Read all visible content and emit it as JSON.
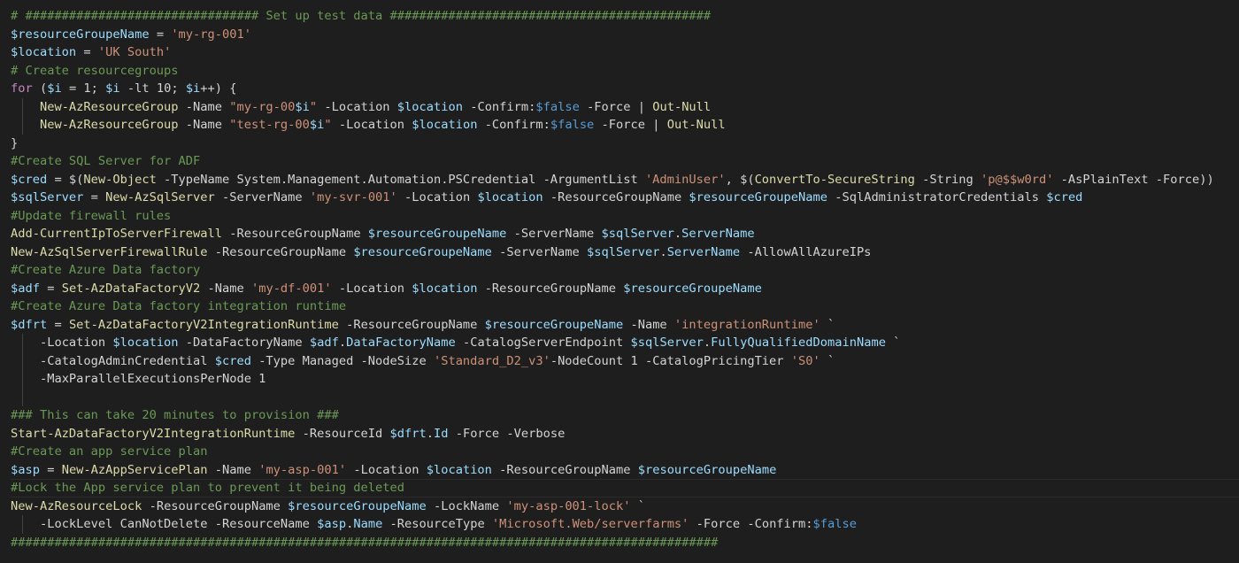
{
  "editor": {
    "background": "#1e1e1e",
    "current_line": 26,
    "lines": [
      {
        "indent": 0,
        "tokens": [
          {
            "t": "com",
            "v": "# ################################ Set up test data ############################################"
          }
        ]
      },
      {
        "indent": 0,
        "tokens": [
          {
            "t": "var",
            "v": "$resourceGroupeName"
          },
          {
            "t": "txt",
            "v": " = "
          },
          {
            "t": "str",
            "v": "'my-rg-001'"
          }
        ]
      },
      {
        "indent": 0,
        "tokens": [
          {
            "t": "var",
            "v": "$location"
          },
          {
            "t": "txt",
            "v": " = "
          },
          {
            "t": "str",
            "v": "'UK South'"
          }
        ]
      },
      {
        "indent": 0,
        "tokens": [
          {
            "t": "com",
            "v": "# Create resourcegroups"
          }
        ]
      },
      {
        "indent": 0,
        "tokens": [
          {
            "t": "kw",
            "v": "for"
          },
          {
            "t": "txt",
            "v": " ("
          },
          {
            "t": "var",
            "v": "$i"
          },
          {
            "t": "txt",
            "v": " = 1; "
          },
          {
            "t": "var",
            "v": "$i"
          },
          {
            "t": "txt",
            "v": " -lt 10; "
          },
          {
            "t": "var",
            "v": "$i"
          },
          {
            "t": "txt",
            "v": "++) {"
          }
        ]
      },
      {
        "indent": 1,
        "tokens": [
          {
            "t": "fn",
            "v": "New-AzResourceGroup"
          },
          {
            "t": "txt",
            "v": " -Name "
          },
          {
            "t": "str",
            "v": "\"my-rg-00"
          },
          {
            "t": "var",
            "v": "$i"
          },
          {
            "t": "str",
            "v": "\""
          },
          {
            "t": "txt",
            "v": " -Location "
          },
          {
            "t": "var",
            "v": "$location"
          },
          {
            "t": "txt",
            "v": " -Confirm:"
          },
          {
            "t": "bool",
            "v": "$false"
          },
          {
            "t": "txt",
            "v": " -Force | "
          },
          {
            "t": "fn",
            "v": "Out-Null"
          }
        ]
      },
      {
        "indent": 1,
        "tokens": [
          {
            "t": "fn",
            "v": "New-AzResourceGroup"
          },
          {
            "t": "txt",
            "v": " -Name "
          },
          {
            "t": "str",
            "v": "\"test-rg-00"
          },
          {
            "t": "var",
            "v": "$i"
          },
          {
            "t": "str",
            "v": "\""
          },
          {
            "t": "txt",
            "v": " -Location "
          },
          {
            "t": "var",
            "v": "$location"
          },
          {
            "t": "txt",
            "v": " -Confirm:"
          },
          {
            "t": "bool",
            "v": "$false"
          },
          {
            "t": "txt",
            "v": " -Force | "
          },
          {
            "t": "fn",
            "v": "Out-Null"
          }
        ]
      },
      {
        "indent": 0,
        "tokens": [
          {
            "t": "txt",
            "v": "}"
          }
        ]
      },
      {
        "indent": 0,
        "tokens": [
          {
            "t": "com",
            "v": "#Create SQL Server for ADF"
          }
        ]
      },
      {
        "indent": 0,
        "tokens": [
          {
            "t": "var",
            "v": "$cred"
          },
          {
            "t": "txt",
            "v": " = $("
          },
          {
            "t": "fn",
            "v": "New-Object"
          },
          {
            "t": "txt",
            "v": " -TypeName System.Management.Automation.PSCredential -ArgumentList "
          },
          {
            "t": "str",
            "v": "'AdminUser'"
          },
          {
            "t": "txt",
            "v": ", $("
          },
          {
            "t": "fn",
            "v": "ConvertTo-SecureString"
          },
          {
            "t": "txt",
            "v": " -String "
          },
          {
            "t": "str",
            "v": "'p@$$w0rd'"
          },
          {
            "t": "txt",
            "v": " -AsPlainText -Force))"
          }
        ]
      },
      {
        "indent": 0,
        "tokens": [
          {
            "t": "var",
            "v": "$sqlServer"
          },
          {
            "t": "txt",
            "v": " = "
          },
          {
            "t": "fn",
            "v": "New-AzSqlServer"
          },
          {
            "t": "txt",
            "v": " -ServerName "
          },
          {
            "t": "str",
            "v": "'my-svr-001'"
          },
          {
            "t": "txt",
            "v": " -Location "
          },
          {
            "t": "var",
            "v": "$location"
          },
          {
            "t": "txt",
            "v": " -ResourceGroupName "
          },
          {
            "t": "var",
            "v": "$resourceGroupeName"
          },
          {
            "t": "txt",
            "v": " -SqlAdministratorCredentials "
          },
          {
            "t": "var",
            "v": "$cred"
          }
        ]
      },
      {
        "indent": 0,
        "tokens": [
          {
            "t": "com",
            "v": "#Update firewall rules"
          }
        ]
      },
      {
        "indent": 0,
        "tokens": [
          {
            "t": "fn",
            "v": "Add-CurrentIpToServerFirewall"
          },
          {
            "t": "txt",
            "v": " -ResourceGroupName "
          },
          {
            "t": "var",
            "v": "$resourceGroupeName"
          },
          {
            "t": "txt",
            "v": " -ServerName "
          },
          {
            "t": "var",
            "v": "$sqlServer"
          },
          {
            "t": "txt",
            "v": "."
          },
          {
            "t": "var",
            "v": "ServerName"
          }
        ]
      },
      {
        "indent": 0,
        "tokens": [
          {
            "t": "fn",
            "v": "New-AzSqlServerFirewallRule"
          },
          {
            "t": "txt",
            "v": " -ResourceGroupName "
          },
          {
            "t": "var",
            "v": "$resourceGroupeName"
          },
          {
            "t": "txt",
            "v": " -ServerName "
          },
          {
            "t": "var",
            "v": "$sqlServer"
          },
          {
            "t": "txt",
            "v": "."
          },
          {
            "t": "var",
            "v": "ServerName"
          },
          {
            "t": "txt",
            "v": " -AllowAllAzureIPs"
          }
        ]
      },
      {
        "indent": 0,
        "tokens": [
          {
            "t": "com",
            "v": "#Create Azure Data factory"
          }
        ]
      },
      {
        "indent": 0,
        "tokens": [
          {
            "t": "var",
            "v": "$adf"
          },
          {
            "t": "txt",
            "v": " = "
          },
          {
            "t": "fn",
            "v": "Set-AzDataFactoryV2"
          },
          {
            "t": "txt",
            "v": " -Name "
          },
          {
            "t": "str",
            "v": "'my-df-001'"
          },
          {
            "t": "txt",
            "v": " -Location "
          },
          {
            "t": "var",
            "v": "$location"
          },
          {
            "t": "txt",
            "v": " -ResourceGroupName "
          },
          {
            "t": "var",
            "v": "$resourceGroupeName"
          }
        ]
      },
      {
        "indent": 0,
        "tokens": [
          {
            "t": "com",
            "v": "#Create Azure Data factory integration runtime"
          }
        ]
      },
      {
        "indent": 0,
        "tokens": [
          {
            "t": "var",
            "v": "$dfrt"
          },
          {
            "t": "txt",
            "v": " = "
          },
          {
            "t": "fn",
            "v": "Set-AzDataFactoryV2IntegrationRuntime"
          },
          {
            "t": "txt",
            "v": " -ResourceGroupName "
          },
          {
            "t": "var",
            "v": "$resourceGroupeName"
          },
          {
            "t": "txt",
            "v": " -Name "
          },
          {
            "t": "str",
            "v": "'integrationRuntime'"
          },
          {
            "t": "txt",
            "v": " `"
          }
        ]
      },
      {
        "indent": 1,
        "tokens": [
          {
            "t": "txt",
            "v": "-Location "
          },
          {
            "t": "var",
            "v": "$location"
          },
          {
            "t": "txt",
            "v": " -DataFactoryName "
          },
          {
            "t": "var",
            "v": "$adf"
          },
          {
            "t": "txt",
            "v": "."
          },
          {
            "t": "var",
            "v": "DataFactoryName"
          },
          {
            "t": "txt",
            "v": " -CatalogServerEndpoint "
          },
          {
            "t": "var",
            "v": "$sqlServer"
          },
          {
            "t": "txt",
            "v": "."
          },
          {
            "t": "var",
            "v": "FullyQualifiedDomainName"
          },
          {
            "t": "txt",
            "v": " `"
          }
        ]
      },
      {
        "indent": 1,
        "tokens": [
          {
            "t": "txt",
            "v": "-CatalogAdminCredential "
          },
          {
            "t": "var",
            "v": "$cred"
          },
          {
            "t": "txt",
            "v": " -Type Managed -NodeSize "
          },
          {
            "t": "str",
            "v": "'Standard_D2_v3'"
          },
          {
            "t": "txt",
            "v": "-NodeCount 1 -CatalogPricingTier "
          },
          {
            "t": "str",
            "v": "'S0'"
          },
          {
            "t": "txt",
            "v": " `"
          }
        ]
      },
      {
        "indent": 1,
        "tokens": [
          {
            "t": "txt",
            "v": "-MaxParallelExecutionsPerNode 1"
          }
        ]
      },
      {
        "indent": 1,
        "tokens": []
      },
      {
        "indent": 0,
        "tokens": [
          {
            "t": "com",
            "v": "### This can take 20 minutes to provision ###"
          }
        ]
      },
      {
        "indent": 0,
        "tokens": [
          {
            "t": "fn",
            "v": "Start-AzDataFactoryV2IntegrationRuntime"
          },
          {
            "t": "txt",
            "v": " -ResourceId "
          },
          {
            "t": "var",
            "v": "$dfrt"
          },
          {
            "t": "txt",
            "v": "."
          },
          {
            "t": "var",
            "v": "Id"
          },
          {
            "t": "txt",
            "v": " -Force -Verbose"
          }
        ]
      },
      {
        "indent": 0,
        "tokens": [
          {
            "t": "com",
            "v": "#Create an app service plan"
          }
        ]
      },
      {
        "indent": 0,
        "tokens": [
          {
            "t": "var",
            "v": "$asp"
          },
          {
            "t": "txt",
            "v": " = "
          },
          {
            "t": "fn",
            "v": "New-AzAppServicePlan"
          },
          {
            "t": "txt",
            "v": " -Name "
          },
          {
            "t": "str",
            "v": "'my-asp-001'"
          },
          {
            "t": "txt",
            "v": " -Location "
          },
          {
            "t": "var",
            "v": "$location"
          },
          {
            "t": "txt",
            "v": " -ResourceGroupName "
          },
          {
            "t": "var",
            "v": "$resourceGroupeName"
          }
        ]
      },
      {
        "indent": 0,
        "tokens": [
          {
            "t": "com",
            "v": "#Lock the App service plan to prevent it being deleted"
          }
        ]
      },
      {
        "indent": 0,
        "tokens": [
          {
            "t": "fn",
            "v": "New-AzResourceLock"
          },
          {
            "t": "txt",
            "v": " -ResourceGroupName "
          },
          {
            "t": "var",
            "v": "$resourceGroupeName"
          },
          {
            "t": "txt",
            "v": " -LockName "
          },
          {
            "t": "str",
            "v": "'my-asp-001-lock'"
          },
          {
            "t": "txt",
            "v": " `"
          }
        ]
      },
      {
        "indent": 1,
        "tokens": [
          {
            "t": "txt",
            "v": "-LockLevel CanNotDelete -ResourceName "
          },
          {
            "t": "var",
            "v": "$asp"
          },
          {
            "t": "txt",
            "v": "."
          },
          {
            "t": "var",
            "v": "Name"
          },
          {
            "t": "txt",
            "v": " -ResourceType "
          },
          {
            "t": "str",
            "v": "'Microsoft.Web/serverfarms'"
          },
          {
            "t": "txt",
            "v": " -Force -Confirm:"
          },
          {
            "t": "bool",
            "v": "$false"
          }
        ]
      },
      {
        "indent": 0,
        "tokens": [
          {
            "t": "com",
            "v": "#################################################################################################"
          }
        ]
      }
    ]
  }
}
